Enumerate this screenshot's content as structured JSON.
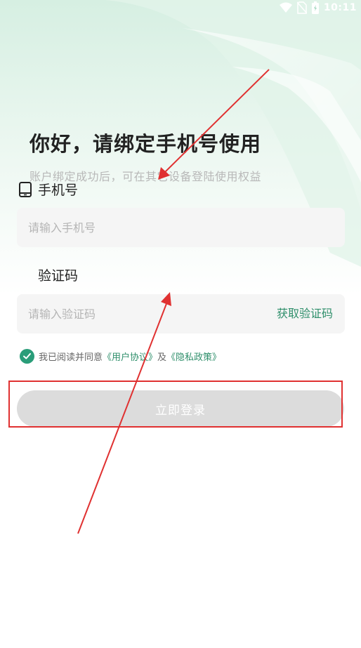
{
  "status_bar": {
    "time": "10:11"
  },
  "page": {
    "title": "你好，请绑定手机号使用",
    "subtitle": "账户绑定成功后，可在其它设备登陆使用权益"
  },
  "phone": {
    "label": "手机号",
    "placeholder": "请输入手机号",
    "value": ""
  },
  "code": {
    "label": "验证码",
    "placeholder": "请输入验证码",
    "value": "",
    "get_code_label": "获取验证码"
  },
  "agreement": {
    "checked": true,
    "prefix": "我已阅读并同意",
    "user_agreement": "《用户协议》",
    "and": "及",
    "privacy_policy": "《隐私政策》"
  },
  "login": {
    "label": "立即登录",
    "enabled": false
  },
  "colors": {
    "accent": "#2f8f6b",
    "check": "#2a9d79",
    "button_disabled": "#dcdcdc",
    "annotation": "#e03131"
  }
}
